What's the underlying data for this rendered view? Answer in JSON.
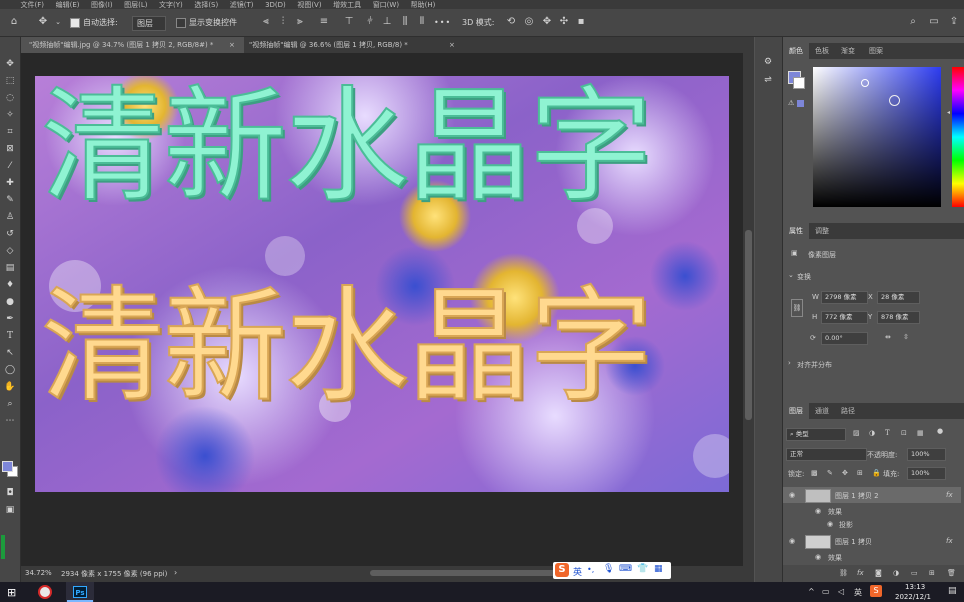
{
  "menu": [
    "文件(F)",
    "编辑(E)",
    "图像(I)",
    "图层(L)",
    "文字(Y)",
    "选择(S)",
    "滤镜(T)",
    "3D(D)",
    "视图(V)",
    "增效工具",
    "窗口(W)",
    "帮助(H)"
  ],
  "options": {
    "auto_select_label": "自动选择:",
    "auto_select_value": "图层",
    "show_transform_label": "显示变换控件",
    "mode_3d_label": "3D 模式:",
    "more_label": "•••"
  },
  "tabs": [
    {
      "label": "\"视频抽帧\"编辑.jpg @ 34.7% (图层 1 拷贝 2, RGB/8#) *",
      "close": "×"
    },
    {
      "label": "\"视频抽帧\"编辑 @ 36.6% (图层 1 拷贝, RGB/8) *",
      "close": "×"
    }
  ],
  "canvas": {
    "line1": "清新水晶字",
    "line2": "清新水晶字",
    "line1_color": "#8ff3d2",
    "line2_color": "#ffd98f"
  },
  "status": {
    "zoom": "34.72%",
    "doc_info": "2934 像素 x 1755 像素 (96 ppi)",
    "arrow": "›"
  },
  "color_panel": {
    "tabs": [
      "颜色",
      "色板",
      "渐变",
      "图案"
    ],
    "fg_color": "#7d86d8",
    "bg_color": "#ffffff"
  },
  "properties_panel": {
    "tabs": [
      "属性",
      "调整"
    ],
    "layer_type": "像素图层",
    "transform_label": "变换",
    "w_label": "W",
    "w_value": "2798 像素",
    "x_label": "X",
    "x_value": "28 像素",
    "h_label": "H",
    "h_value": "772 像素",
    "y_label": "Y",
    "y_value": "878 像素",
    "angle_value": "0.00°",
    "align_label": "对齐并分布"
  },
  "layers_panel": {
    "tabs": [
      "图层",
      "通道",
      "路径"
    ],
    "filter_value": "类型",
    "blend_mode": "正常",
    "opacity_label": "不透明度:",
    "opacity_value": "100%",
    "lock_label": "锁定:",
    "fill_label": "填充:",
    "fill_value": "100%",
    "layers": [
      {
        "name": "图层 1 拷贝 2",
        "fx": "fx"
      },
      {
        "name": "效果"
      },
      {
        "name": "投影"
      },
      {
        "name": "图层 1 拷贝",
        "fx": "fx"
      },
      {
        "name": "效果"
      }
    ]
  },
  "ime": {
    "logo": "S",
    "lang": "英",
    "dot": "•,"
  },
  "taskbar": {
    "ps_label": "Ps",
    "time": "13:13",
    "date": "2022/12/1",
    "lang": "英"
  }
}
